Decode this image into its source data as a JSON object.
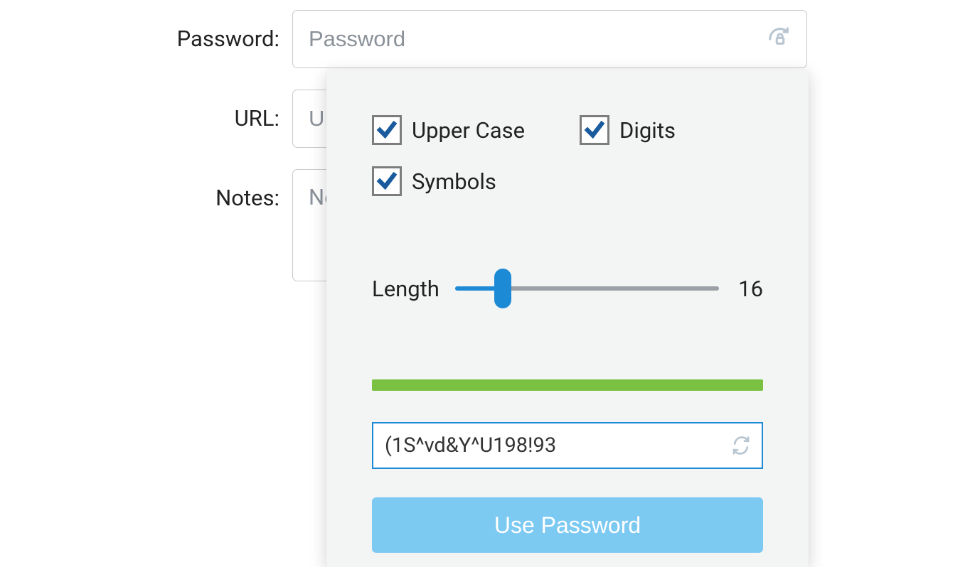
{
  "form": {
    "password": {
      "label": "Password:",
      "placeholder": "Password",
      "value": ""
    },
    "url": {
      "label": "URL:",
      "placeholder": "URL",
      "value": ""
    },
    "notes": {
      "label": "Notes:",
      "placeholder": "Notes",
      "value": ""
    }
  },
  "generator": {
    "options": {
      "upper_case": {
        "label": "Upper Case",
        "checked": true
      },
      "digits": {
        "label": "Digits",
        "checked": true
      },
      "symbols": {
        "label": "Symbols",
        "checked": true
      }
    },
    "length": {
      "label": "Length",
      "value": "16"
    },
    "strength_color": "#7ac142",
    "generated_password": "(1S^vd&Y^U198!93",
    "use_button_label": "Use Password"
  },
  "colors": {
    "accent": "#1d8ad6",
    "button": "#7cc9f2",
    "border": "#c9c9c9"
  }
}
